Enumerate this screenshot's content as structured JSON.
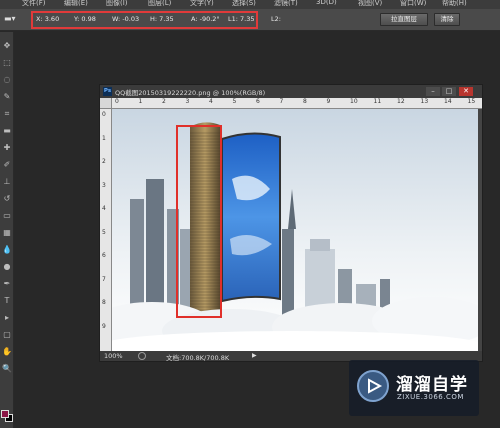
{
  "menubar": {
    "items": [
      "文件(F)",
      "编辑(E)",
      "图像(I)",
      "图层(L)",
      "文字(Y)",
      "选择(S)",
      "滤镜(T)",
      "3D(D)",
      "视图(V)",
      "窗口(W)",
      "帮助(H)"
    ]
  },
  "options": {
    "tool_icon": "ruler-tool-icon",
    "readouts": [
      {
        "label": "X:",
        "value": "3.60"
      },
      {
        "label": "Y:",
        "value": "0.98"
      },
      {
        "label": "W:",
        "value": "-0.03"
      },
      {
        "label": "H:",
        "value": "7.35"
      },
      {
        "label": "A:",
        "value": "-90.2°"
      },
      {
        "label": "L1:",
        "value": "7.35"
      }
    ],
    "l2_label": "L2:",
    "straighten_button": "拉直图层",
    "clear_button": "清除",
    "highlight_color": "#e03a3a"
  },
  "tools": [
    "move-tool-icon",
    "marquee-tool-icon",
    "lasso-tool-icon",
    "quick-select-tool-icon",
    "crop-tool-icon",
    "ruler-tool-icon",
    "healing-brush-tool-icon",
    "brush-tool-icon",
    "clone-stamp-tool-icon",
    "history-brush-tool-icon",
    "eraser-tool-icon",
    "gradient-tool-icon",
    "blur-tool-icon",
    "dodge-tool-icon",
    "pen-tool-icon",
    "type-tool-icon",
    "path-select-tool-icon",
    "shape-tool-icon",
    "hand-tool-icon",
    "zoom-tool-icon"
  ],
  "colors": {
    "foreground": "#8a1444",
    "background": "#000000"
  },
  "document": {
    "title": "QQ截图20150319222220.png @ 100%(RGB/8)",
    "ruler_h": [
      "0",
      "1",
      "2",
      "3",
      "4",
      "5",
      "6",
      "7",
      "8",
      "9",
      "10",
      "11",
      "12",
      "13",
      "14",
      "15"
    ],
    "ruler_v": [
      "0",
      "1",
      "2",
      "3",
      "4",
      "5",
      "6",
      "7",
      "8",
      "9"
    ],
    "zoom": "100%",
    "doc_size": "文档:700.8K/700.8K",
    "selection_color": "#e0302a"
  },
  "watermark": {
    "brand": "溜溜自学",
    "url": "ZIXUE.3066.COM"
  }
}
